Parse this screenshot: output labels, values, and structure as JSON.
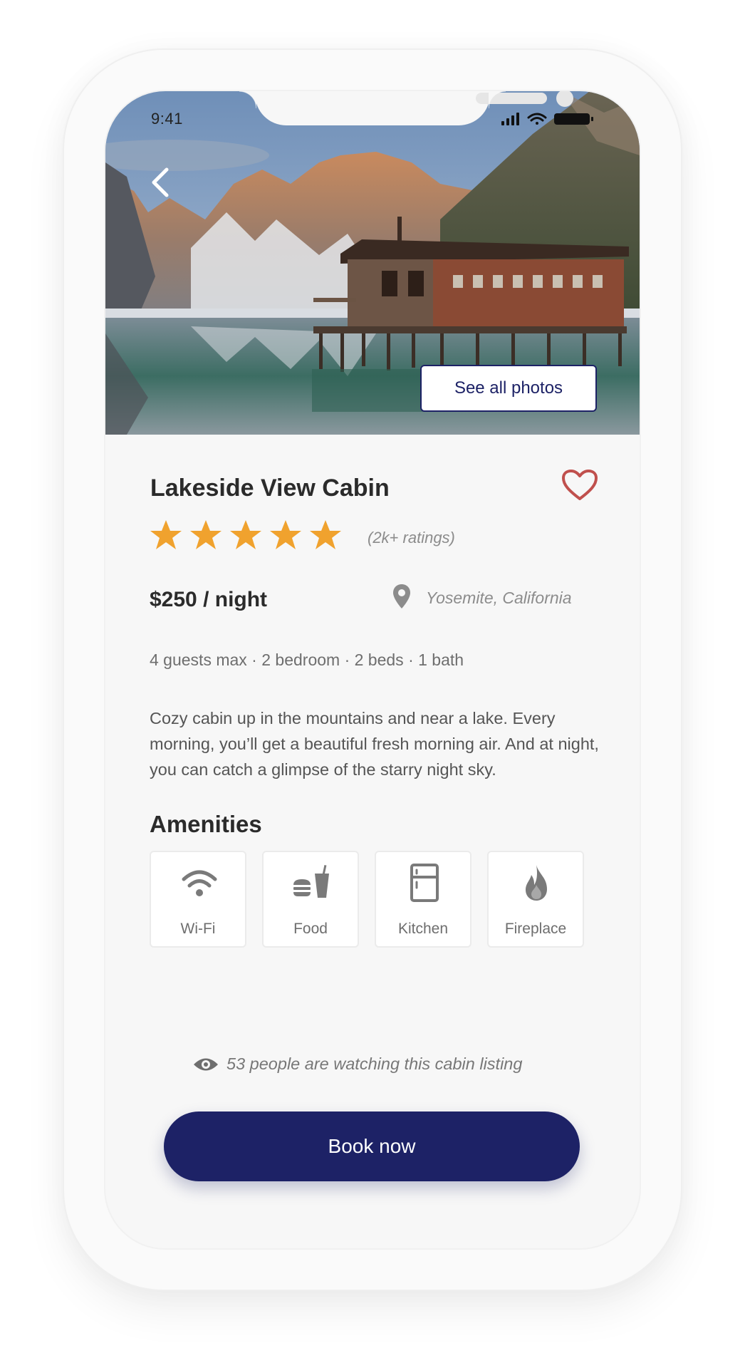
{
  "status_bar": {
    "time": "9:41"
  },
  "hero": {
    "see_all_photos_label": "See all photos"
  },
  "listing": {
    "title": "Lakeside View Cabin",
    "rating_stars": 5,
    "ratings_count": "(2k+ ratings)",
    "price": "$250 / night",
    "location": "Yosemite, California",
    "details": "4 guests max · 2 bedroom · 2 beds · 1 bath",
    "description": "Cozy cabin up in the mountains and near a lake. Every morning, you’ll get a beautiful fresh morning air. And at night, you can catch a glimpse of the starry night sky."
  },
  "amenities": {
    "heading": "Amenities",
    "items": [
      {
        "label": "Wi-Fi",
        "icon": "wifi-icon"
      },
      {
        "label": "Food",
        "icon": "food-icon"
      },
      {
        "label": "Kitchen",
        "icon": "kitchen-icon"
      },
      {
        "label": "Fireplace",
        "icon": "fireplace-icon"
      }
    ]
  },
  "watchers": {
    "text": "53 people are watching this cabin listing"
  },
  "cta": {
    "book_label": "Book now"
  },
  "colors": {
    "primary": "#1d2266",
    "star": "#f0a22e",
    "heart": "#c0504d",
    "text_dark": "#2b2b2b",
    "text_muted": "#8c8c8c"
  }
}
